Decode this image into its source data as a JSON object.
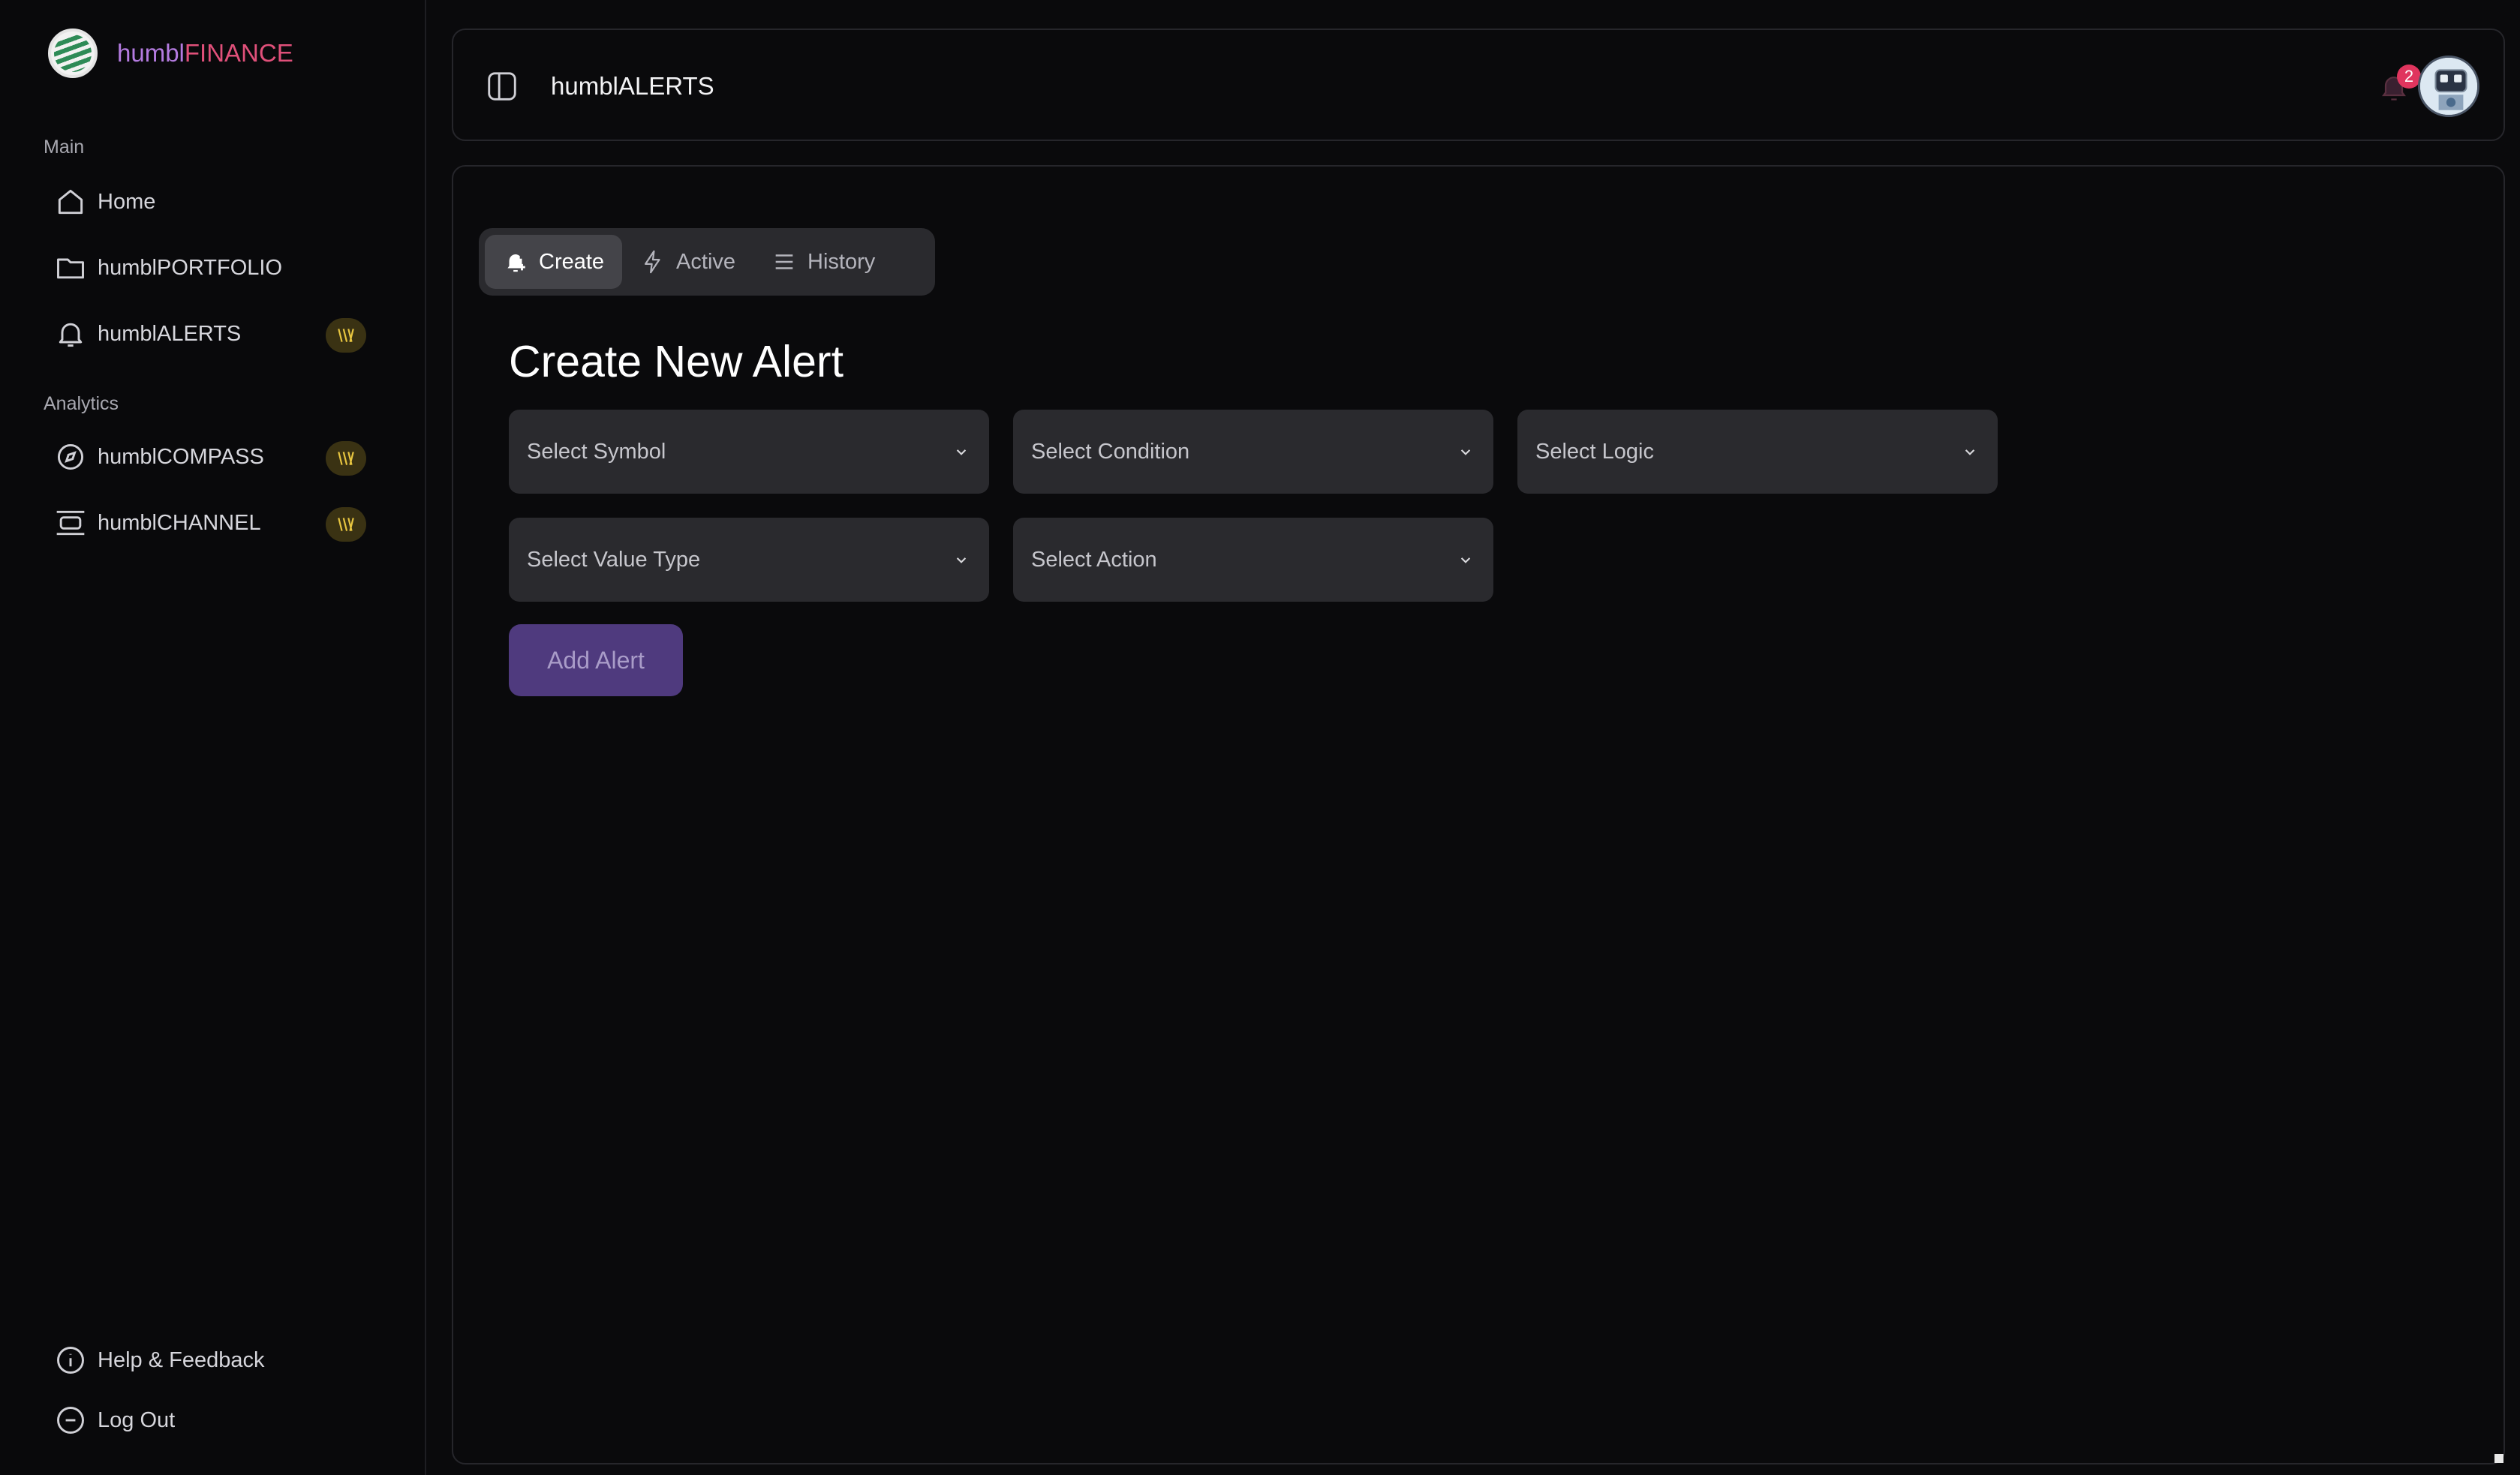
{
  "brand": {
    "name_part1": "humbl",
    "name_part2": "FINANCE"
  },
  "sidebar": {
    "sections": [
      {
        "label": "Main"
      },
      {
        "label": "Analytics"
      }
    ],
    "items": [
      {
        "label": "Home",
        "icon": "home-icon"
      },
      {
        "label": "humblPORTFOLIO",
        "icon": "folder-icon"
      },
      {
        "label": "humblALERTS",
        "icon": "bell-icon",
        "badge": "premium-badge-icon"
      },
      {
        "label": "humblCOMPASS",
        "icon": "compass-icon",
        "badge": "premium-badge-icon"
      },
      {
        "label": "humblCHANNEL",
        "icon": "channel-icon",
        "badge": "premium-badge-icon"
      }
    ],
    "footer": [
      {
        "label": "Help & Feedback",
        "icon": "info-icon"
      },
      {
        "label": "Log Out",
        "icon": "logout-icon"
      }
    ]
  },
  "header": {
    "title": "humblALERTS",
    "notification_count": "2"
  },
  "tabs": [
    {
      "label": "Create",
      "icon": "bell-plus-icon"
    },
    {
      "label": "Active",
      "icon": "lightning-icon"
    },
    {
      "label": "History",
      "icon": "list-icon"
    }
  ],
  "main": {
    "title": "Create New Alert",
    "selects": {
      "symbol": "Select Symbol",
      "condition": "Select Condition",
      "logic": "Select Logic",
      "value_type": "Select Value Type",
      "action": "Select Action"
    },
    "add_button": "Add Alert"
  },
  "colors": {
    "accent": "#4f3a7e",
    "brand_purple": "#b47be0",
    "brand_pink": "#e0507a",
    "notification": "#e0355e",
    "badge_bg": "#3a3213",
    "badge_fg": "#e8c640"
  }
}
